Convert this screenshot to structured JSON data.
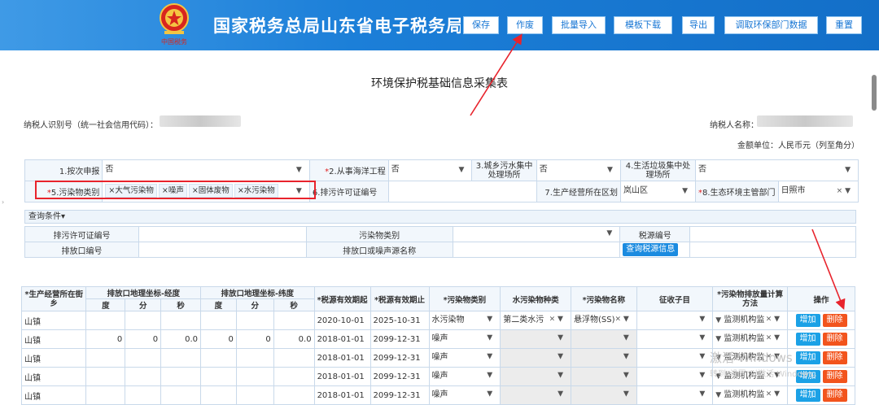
{
  "header": {
    "brand_title": "国家税务总局山东省电子税务局",
    "emblem_text": "中国税务",
    "buttons": [
      "保存",
      "作废",
      "批量导入",
      "模板下载",
      "导出",
      "调取环保部门数据",
      "重置"
    ]
  },
  "form": {
    "title": "环境保护税基础信息采集表",
    "taxpayer_id_label": "纳税人识别号（统一社会信用代码）：",
    "taxpayer_name_label": "纳税人名称：",
    "amount_unit": "金额单位：人民币元（列至角分）"
  },
  "basic": {
    "f1_label": "1.按次申报",
    "f1_value": "否",
    "f2_req": "*",
    "f2_label": "2.从事海洋工程",
    "f2_value": "否",
    "f3_label": "3.城乡污水集中处理场所",
    "f3_value": "否",
    "f4_label": "4.生活垃圾集中处理场所",
    "f4_value": "否",
    "f5_req": "*",
    "f5_label": "5.污染物类别",
    "f5_tags": [
      "×大气污染物",
      "×噪声",
      "×固体废物",
      "×水污染物"
    ],
    "f6_label": "6.排污许可证编号",
    "f7_label": "7.生产经营所在区划",
    "f7_value": "岚山区",
    "f8_req": "*",
    "f8_label": "8.生态环境主管部门",
    "f8_value": "日照市"
  },
  "query": {
    "toggle_label": "查询条件▾",
    "permit_label": "排污许可证编号",
    "pollutant_cat_label": "污染物类别",
    "tax_source_label": "税源编号",
    "outlet_label": "排放口编号",
    "outlet_name_label": "排放口或噪声源名称",
    "query_button": "查询税源信息"
  },
  "grid": {
    "headers": {
      "street": "*生产经营所在街乡",
      "lng": "排放口地理坐标-经度",
      "lat": "排放口地理坐标-纬度",
      "deg": "度",
      "min": "分",
      "sec": "秒",
      "start": "*税源有效期起",
      "end": "*税源有效期止",
      "pollutant_cat": "*污染物类别",
      "water_kind": "水污染物种类",
      "pollutant_name": "*污染物名称",
      "sub_item": "征收子目",
      "method": "*污染物排放量计算方法",
      "ops": "操作"
    },
    "rows": [
      {
        "street": "山镇",
        "lng_d": "",
        "lng_m": "",
        "lng_s": "",
        "lat_d": "",
        "lat_m": "",
        "lat_s": "",
        "start": "2020-10-01",
        "end": "2025-10-31",
        "cat": "水污染物",
        "water": "第二类水污",
        "name": "悬浮物(SS)",
        "method": "监测机构监"
      },
      {
        "street": "山镇",
        "lng_d": "0",
        "lng_m": "0",
        "lng_s": "0.0",
        "lat_d": "0",
        "lat_m": "0",
        "lat_s": "0.0",
        "start": "2018-01-01",
        "end": "2099-12-31",
        "cat": "噪声",
        "water": "",
        "name": "",
        "method": "监测机构监"
      },
      {
        "street": "山镇",
        "lng_d": "",
        "lng_m": "",
        "lng_s": "",
        "lat_d": "",
        "lat_m": "",
        "lat_s": "",
        "start": "2018-01-01",
        "end": "2099-12-31",
        "cat": "噪声",
        "water": "",
        "name": "",
        "method": "监测机构监"
      },
      {
        "street": "山镇",
        "lng_d": "",
        "lng_m": "",
        "lng_s": "",
        "lat_d": "",
        "lat_m": "",
        "lat_s": "",
        "start": "2018-01-01",
        "end": "2099-12-31",
        "cat": "噪声",
        "water": "",
        "name": "",
        "method": "监测机构监"
      },
      {
        "street": "山镇",
        "lng_d": "",
        "lng_m": "",
        "lng_s": "",
        "lat_d": "",
        "lat_m": "",
        "lat_s": "",
        "start": "2018-01-01",
        "end": "2099-12-31",
        "cat": "噪声",
        "water": "",
        "name": "",
        "method": "监测机构监"
      }
    ],
    "add_label": "增加",
    "delete_label": "删除"
  },
  "watermark": {
    "line1": "激活 Windows",
    "line2": "转到\"设置\"以激活 Windows。"
  },
  "colors": {
    "header_blue": "#1c7fd8",
    "annotation_red": "#e8232c",
    "add_blue": "#1ba1e6",
    "delete_orange": "#f2541d"
  }
}
